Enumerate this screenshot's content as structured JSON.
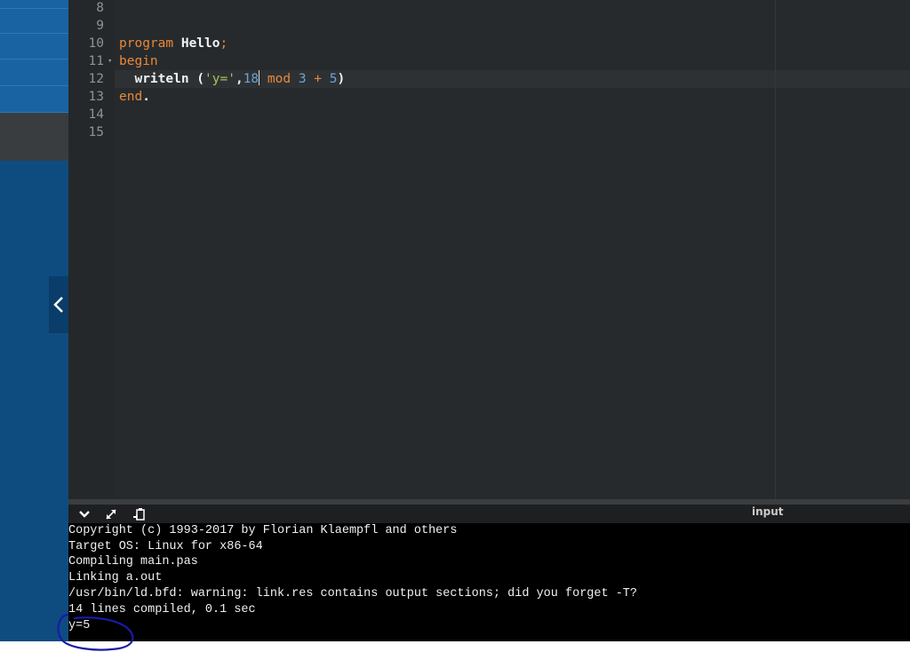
{
  "editor": {
    "line_numbers": [
      "8",
      "9",
      "10",
      "11",
      "12",
      "13",
      "14",
      "15"
    ],
    "code": {
      "line10": {
        "kw": "program",
        "name": " Hello",
        "semi": ";"
      },
      "line11": {
        "kw": "begin"
      },
      "line12": {
        "indent": "  ",
        "fn": "writeln",
        "open": " (",
        "str": "'y='",
        "comma": ",",
        "num1": "18",
        "kw": " mod",
        "sp": " ",
        "num2": "3",
        "plus": " + ",
        "num3": "5",
        "close": ")"
      },
      "line13": {
        "kw": "end",
        "dot": "."
      }
    }
  },
  "toolbar": {
    "input_label": "input",
    "icons": [
      "chevron-down-icon",
      "expand-arrows-icon",
      "clipboard-icon"
    ]
  },
  "terminal": {
    "lines": [
      "Copyright (c) 1993-2017 by Florian Klaempfl and others",
      "Target OS: Linux for x86-64",
      "Compiling main.pas",
      "Linking a.out",
      "/usr/bin/ld.bfd: warning: link.res contains output sections; did you forget -T?",
      "14 lines compiled, 0.1 sec",
      "y=5"
    ]
  },
  "colors": {
    "sidebar_blue": "#0e4c80",
    "editor_bg": "#272a2c",
    "keyword": "#e8883a",
    "string": "#a3c65a",
    "number": "#6aa4d8",
    "annotation_ink": "#1a1aa8"
  }
}
